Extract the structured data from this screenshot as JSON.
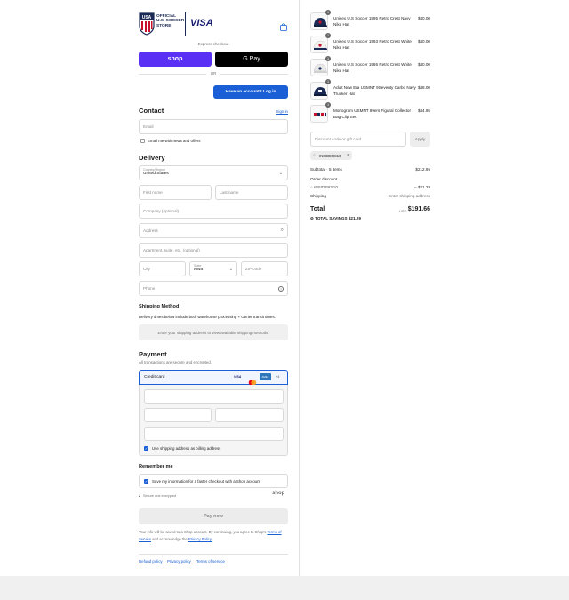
{
  "header": {
    "logo_text": "OFFICIAL U.S. SOCCER STORE",
    "sponsor": "VISA"
  },
  "express": {
    "title": "Express checkout",
    "shop_label": "shop",
    "gpay_label": "G Pay",
    "or_label": "OR",
    "login_label": "Have an account? Log in"
  },
  "contact": {
    "title": "Contact",
    "sign_in": "Sign in",
    "email_placeholder": "Email",
    "news_label": "Email me with news and offers"
  },
  "delivery": {
    "title": "Delivery",
    "country_label": "Country/Region",
    "country_value": "United States",
    "first_name": "First name",
    "last_name": "Last name",
    "company": "Company (optional)",
    "address": "Address",
    "apartment": "Apartment, suite, etc. (optional)",
    "city": "City",
    "state_label": "State",
    "state_value": "Iowa",
    "zip": "ZIP code",
    "phone": "Phone"
  },
  "shipping": {
    "title": "Shipping Method",
    "note": "Delivery times below include both warehouse processing + carrier transit times.",
    "placeholder": "Enter your shipping address to view available shipping methods."
  },
  "payment": {
    "title": "Payment",
    "subtitle": "All transactions are secure and encrypted.",
    "credit_card": "Credit card",
    "card_visa": "VISA",
    "card_amex": "AMEX",
    "card_more": "+4",
    "billing_label": "Use shipping address as billing address"
  },
  "remember": {
    "title": "Remember me",
    "save_label": "Save my information for a faster checkout with a Shop account",
    "secure": "Secure and encrypted",
    "shop_brand": "shop"
  },
  "pay": {
    "button": "Pay now",
    "legal_1": "Your info will be saved to a Shop account. By continuing, you agree to Shop's",
    "terms_link": "Terms of Service",
    "legal_2": "and acknowledge the",
    "privacy_link": "Privacy Policy."
  },
  "footer": {
    "refund": "Refund policy",
    "privacy": "Privacy policy",
    "terms": "Terms of service"
  },
  "cart": {
    "items": [
      {
        "qty": "1",
        "name": "Unisex U.S Soccer 1995 Retro Crest Navy Nike Hat",
        "price": "$40.00"
      },
      {
        "qty": "1",
        "name": "Unisex U.S Soccer 1993 Retro Crest White Nike Hat",
        "price": "$40.00"
      },
      {
        "qty": "1",
        "name": "Unisex U.S Soccer 1986 Retro Crest White Nike Hat",
        "price": "$40.00"
      },
      {
        "qty": "1",
        "name": "Adult New Era USMNT 9Seventy Carbo Navy Trucker Hat",
        "price": "$48.00"
      },
      {
        "qty": "1",
        "name": "Monogram USMNT 99ers Figural Collector Bag Clip Set",
        "price": "$44.95"
      }
    ],
    "discount_placeholder": "Discount code or gift card",
    "apply": "Apply",
    "code": "INSIDERS10",
    "subtotal_label": "Subtotal · 5 items",
    "subtotal_value": "$212.95",
    "order_discount": "Order discount",
    "discount_code": "INSIDERS10",
    "discount_value": "− $21.29",
    "shipping_label": "Shipping",
    "shipping_value": "Enter shipping address",
    "total_label": "Total",
    "currency": "USD",
    "total_value": "$191.66",
    "savings_label": "TOTAL SAVINGS",
    "savings_value": "$21.29"
  },
  "colors": {
    "accent": "#1a5fd6",
    "shop": "#5a31f4"
  }
}
